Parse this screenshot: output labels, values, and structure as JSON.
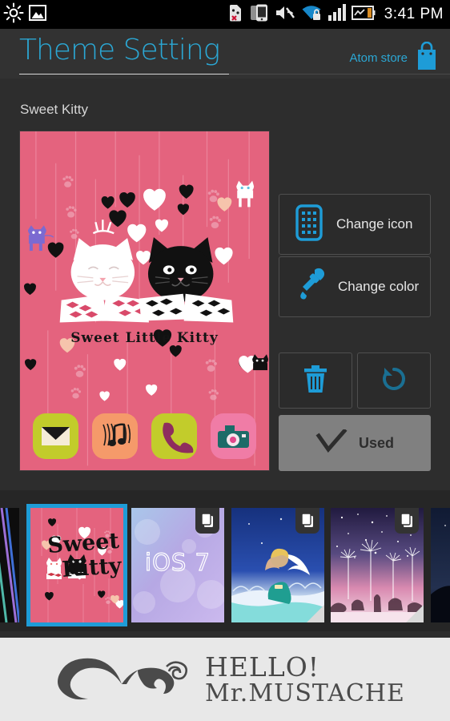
{
  "statusbar": {
    "time": "3:41 PM",
    "left_icons": [
      {
        "name": "brightness-sun-icon"
      },
      {
        "name": "gallery-picture-icon"
      }
    ],
    "right_icons": [
      {
        "name": "no-sim-card-icon"
      },
      {
        "name": "connected-device-icon"
      },
      {
        "name": "volume-muted-icon"
      },
      {
        "name": "wifi-secured-icon"
      },
      {
        "name": "signal-bars-icon"
      },
      {
        "name": "battery-icon"
      }
    ]
  },
  "header": {
    "title": "Theme Setting",
    "store_label": "Atom store",
    "store_icon": "shopping-bag-icon",
    "accent_color": "#2ba7d4"
  },
  "content": {
    "theme_name": "Sweet Kitty",
    "preview": {
      "caption": "Sweet Little Kitty",
      "background_color": "#e4637e",
      "dock_icons": [
        {
          "name": "mail-app-icon",
          "color": "#c2cc2b"
        },
        {
          "name": "music-app-icon",
          "color": "#f59a6a"
        },
        {
          "name": "phone-app-icon",
          "color": "#c2cc2b"
        },
        {
          "name": "camera-app-icon",
          "color": "#f07ca6"
        }
      ]
    },
    "actions": [
      {
        "name": "change-icon-button",
        "label": "Change icon",
        "icon": "icon-grid-phone-icon"
      },
      {
        "name": "change-color-button",
        "label": "Change color",
        "icon": "eyedropper-icon"
      }
    ],
    "delete_button": {
      "icon": "trash-icon"
    },
    "restore_button": {
      "icon": "restore-undo-icon"
    },
    "used_button": {
      "label": "Used",
      "icon": "check-icon",
      "color": "#808080"
    }
  },
  "thumbnails": [
    {
      "name": "theme-thumb-partial-left",
      "label": "",
      "selected": false,
      "badge": false
    },
    {
      "name": "theme-thumb-sweet-kitty",
      "label": "Sweet Kitty",
      "selected": true,
      "badge": false
    },
    {
      "name": "theme-thumb-ios7",
      "label": "iOS 7",
      "selected": false,
      "badge": true
    },
    {
      "name": "theme-thumb-little-prince",
      "label": "",
      "selected": false,
      "badge": true
    },
    {
      "name": "theme-thumb-dandelion-night",
      "label": "",
      "selected": false,
      "badge": true
    },
    {
      "name": "theme-thumb-partial-right",
      "label": "",
      "selected": false,
      "badge": false
    }
  ],
  "ad": {
    "line1": "HELLO!",
    "line2": "Mr.MUSTACHE",
    "icon": "mustache-icon",
    "background_color": "#e8e8e8"
  }
}
